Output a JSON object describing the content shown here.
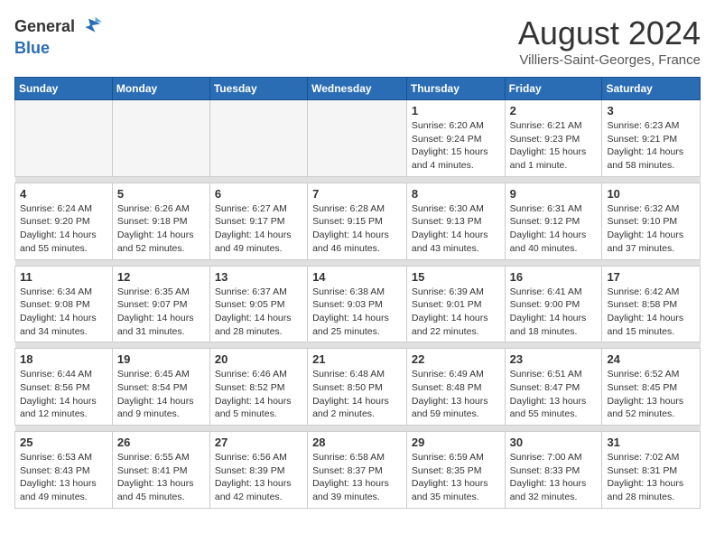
{
  "header": {
    "logo_general": "General",
    "logo_blue": "Blue",
    "month_year": "August 2024",
    "location": "Villiers-Saint-Georges, France"
  },
  "weekdays": [
    "Sunday",
    "Monday",
    "Tuesday",
    "Wednesday",
    "Thursday",
    "Friday",
    "Saturday"
  ],
  "weeks": [
    {
      "days": [
        {
          "num": "",
          "info": ""
        },
        {
          "num": "",
          "info": ""
        },
        {
          "num": "",
          "info": ""
        },
        {
          "num": "",
          "info": ""
        },
        {
          "num": "1",
          "info": "Sunrise: 6:20 AM\nSunset: 9:24 PM\nDaylight: 15 hours\nand 4 minutes."
        },
        {
          "num": "2",
          "info": "Sunrise: 6:21 AM\nSunset: 9:23 PM\nDaylight: 15 hours\nand 1 minute."
        },
        {
          "num": "3",
          "info": "Sunrise: 6:23 AM\nSunset: 9:21 PM\nDaylight: 14 hours\nand 58 minutes."
        }
      ]
    },
    {
      "days": [
        {
          "num": "4",
          "info": "Sunrise: 6:24 AM\nSunset: 9:20 PM\nDaylight: 14 hours\nand 55 minutes."
        },
        {
          "num": "5",
          "info": "Sunrise: 6:26 AM\nSunset: 9:18 PM\nDaylight: 14 hours\nand 52 minutes."
        },
        {
          "num": "6",
          "info": "Sunrise: 6:27 AM\nSunset: 9:17 PM\nDaylight: 14 hours\nand 49 minutes."
        },
        {
          "num": "7",
          "info": "Sunrise: 6:28 AM\nSunset: 9:15 PM\nDaylight: 14 hours\nand 46 minutes."
        },
        {
          "num": "8",
          "info": "Sunrise: 6:30 AM\nSunset: 9:13 PM\nDaylight: 14 hours\nand 43 minutes."
        },
        {
          "num": "9",
          "info": "Sunrise: 6:31 AM\nSunset: 9:12 PM\nDaylight: 14 hours\nand 40 minutes."
        },
        {
          "num": "10",
          "info": "Sunrise: 6:32 AM\nSunset: 9:10 PM\nDaylight: 14 hours\nand 37 minutes."
        }
      ]
    },
    {
      "days": [
        {
          "num": "11",
          "info": "Sunrise: 6:34 AM\nSunset: 9:08 PM\nDaylight: 14 hours\nand 34 minutes."
        },
        {
          "num": "12",
          "info": "Sunrise: 6:35 AM\nSunset: 9:07 PM\nDaylight: 14 hours\nand 31 minutes."
        },
        {
          "num": "13",
          "info": "Sunrise: 6:37 AM\nSunset: 9:05 PM\nDaylight: 14 hours\nand 28 minutes."
        },
        {
          "num": "14",
          "info": "Sunrise: 6:38 AM\nSunset: 9:03 PM\nDaylight: 14 hours\nand 25 minutes."
        },
        {
          "num": "15",
          "info": "Sunrise: 6:39 AM\nSunset: 9:01 PM\nDaylight: 14 hours\nand 22 minutes."
        },
        {
          "num": "16",
          "info": "Sunrise: 6:41 AM\nSunset: 9:00 PM\nDaylight: 14 hours\nand 18 minutes."
        },
        {
          "num": "17",
          "info": "Sunrise: 6:42 AM\nSunset: 8:58 PM\nDaylight: 14 hours\nand 15 minutes."
        }
      ]
    },
    {
      "days": [
        {
          "num": "18",
          "info": "Sunrise: 6:44 AM\nSunset: 8:56 PM\nDaylight: 14 hours\nand 12 minutes."
        },
        {
          "num": "19",
          "info": "Sunrise: 6:45 AM\nSunset: 8:54 PM\nDaylight: 14 hours\nand 9 minutes."
        },
        {
          "num": "20",
          "info": "Sunrise: 6:46 AM\nSunset: 8:52 PM\nDaylight: 14 hours\nand 5 minutes."
        },
        {
          "num": "21",
          "info": "Sunrise: 6:48 AM\nSunset: 8:50 PM\nDaylight: 14 hours\nand 2 minutes."
        },
        {
          "num": "22",
          "info": "Sunrise: 6:49 AM\nSunset: 8:48 PM\nDaylight: 13 hours\nand 59 minutes."
        },
        {
          "num": "23",
          "info": "Sunrise: 6:51 AM\nSunset: 8:47 PM\nDaylight: 13 hours\nand 55 minutes."
        },
        {
          "num": "24",
          "info": "Sunrise: 6:52 AM\nSunset: 8:45 PM\nDaylight: 13 hours\nand 52 minutes."
        }
      ]
    },
    {
      "days": [
        {
          "num": "25",
          "info": "Sunrise: 6:53 AM\nSunset: 8:43 PM\nDaylight: 13 hours\nand 49 minutes."
        },
        {
          "num": "26",
          "info": "Sunrise: 6:55 AM\nSunset: 8:41 PM\nDaylight: 13 hours\nand 45 minutes."
        },
        {
          "num": "27",
          "info": "Sunrise: 6:56 AM\nSunset: 8:39 PM\nDaylight: 13 hours\nand 42 minutes."
        },
        {
          "num": "28",
          "info": "Sunrise: 6:58 AM\nSunset: 8:37 PM\nDaylight: 13 hours\nand 39 minutes."
        },
        {
          "num": "29",
          "info": "Sunrise: 6:59 AM\nSunset: 8:35 PM\nDaylight: 13 hours\nand 35 minutes."
        },
        {
          "num": "30",
          "info": "Sunrise: 7:00 AM\nSunset: 8:33 PM\nDaylight: 13 hours\nand 32 minutes."
        },
        {
          "num": "31",
          "info": "Sunrise: 7:02 AM\nSunset: 8:31 PM\nDaylight: 13 hours\nand 28 minutes."
        }
      ]
    }
  ]
}
